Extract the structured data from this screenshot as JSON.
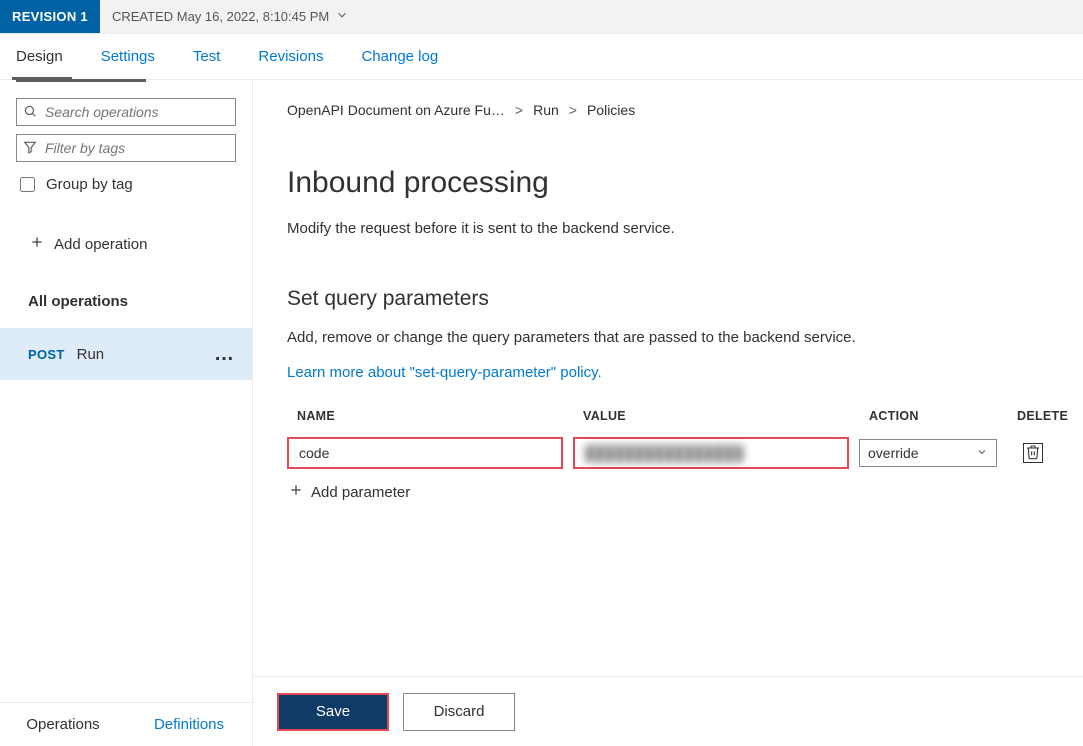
{
  "revision": {
    "badge": "REVISION 1",
    "created": "CREATED May 16, 2022, 8:10:45 PM"
  },
  "tabs": {
    "design": "Design",
    "settings": "Settings",
    "test": "Test",
    "revisions": "Revisions",
    "changelog": "Change log"
  },
  "sidebar": {
    "search_placeholder": "Search operations",
    "filter_placeholder": "Filter by tags",
    "group_by_label": "Group by tag",
    "add_operation": "Add operation",
    "all_operations": "All operations",
    "item": {
      "method": "POST",
      "name": "Run"
    },
    "bottom_tabs": {
      "operations": "Operations",
      "definitions": "Definitions"
    }
  },
  "breadcrumb": {
    "api": "OpenAPI Document on Azure Fu…",
    "op": "Run",
    "last": "Policies",
    "sep": ">"
  },
  "page": {
    "h1": "Inbound processing",
    "desc": "Modify the request before it is sent to the backend service.",
    "h2": "Set query parameters",
    "desc2": "Add, remove or change the query parameters that are passed to the backend service.",
    "learn": "Learn more about \"set-query-parameter\" policy."
  },
  "table": {
    "headers": {
      "name": "NAME",
      "value": "VALUE",
      "action": "ACTION",
      "delete": "DELETE"
    },
    "row": {
      "name": "code",
      "value": "████████████████",
      "action": "override"
    },
    "add_param": "Add parameter"
  },
  "footer": {
    "save": "Save",
    "discard": "Discard"
  }
}
